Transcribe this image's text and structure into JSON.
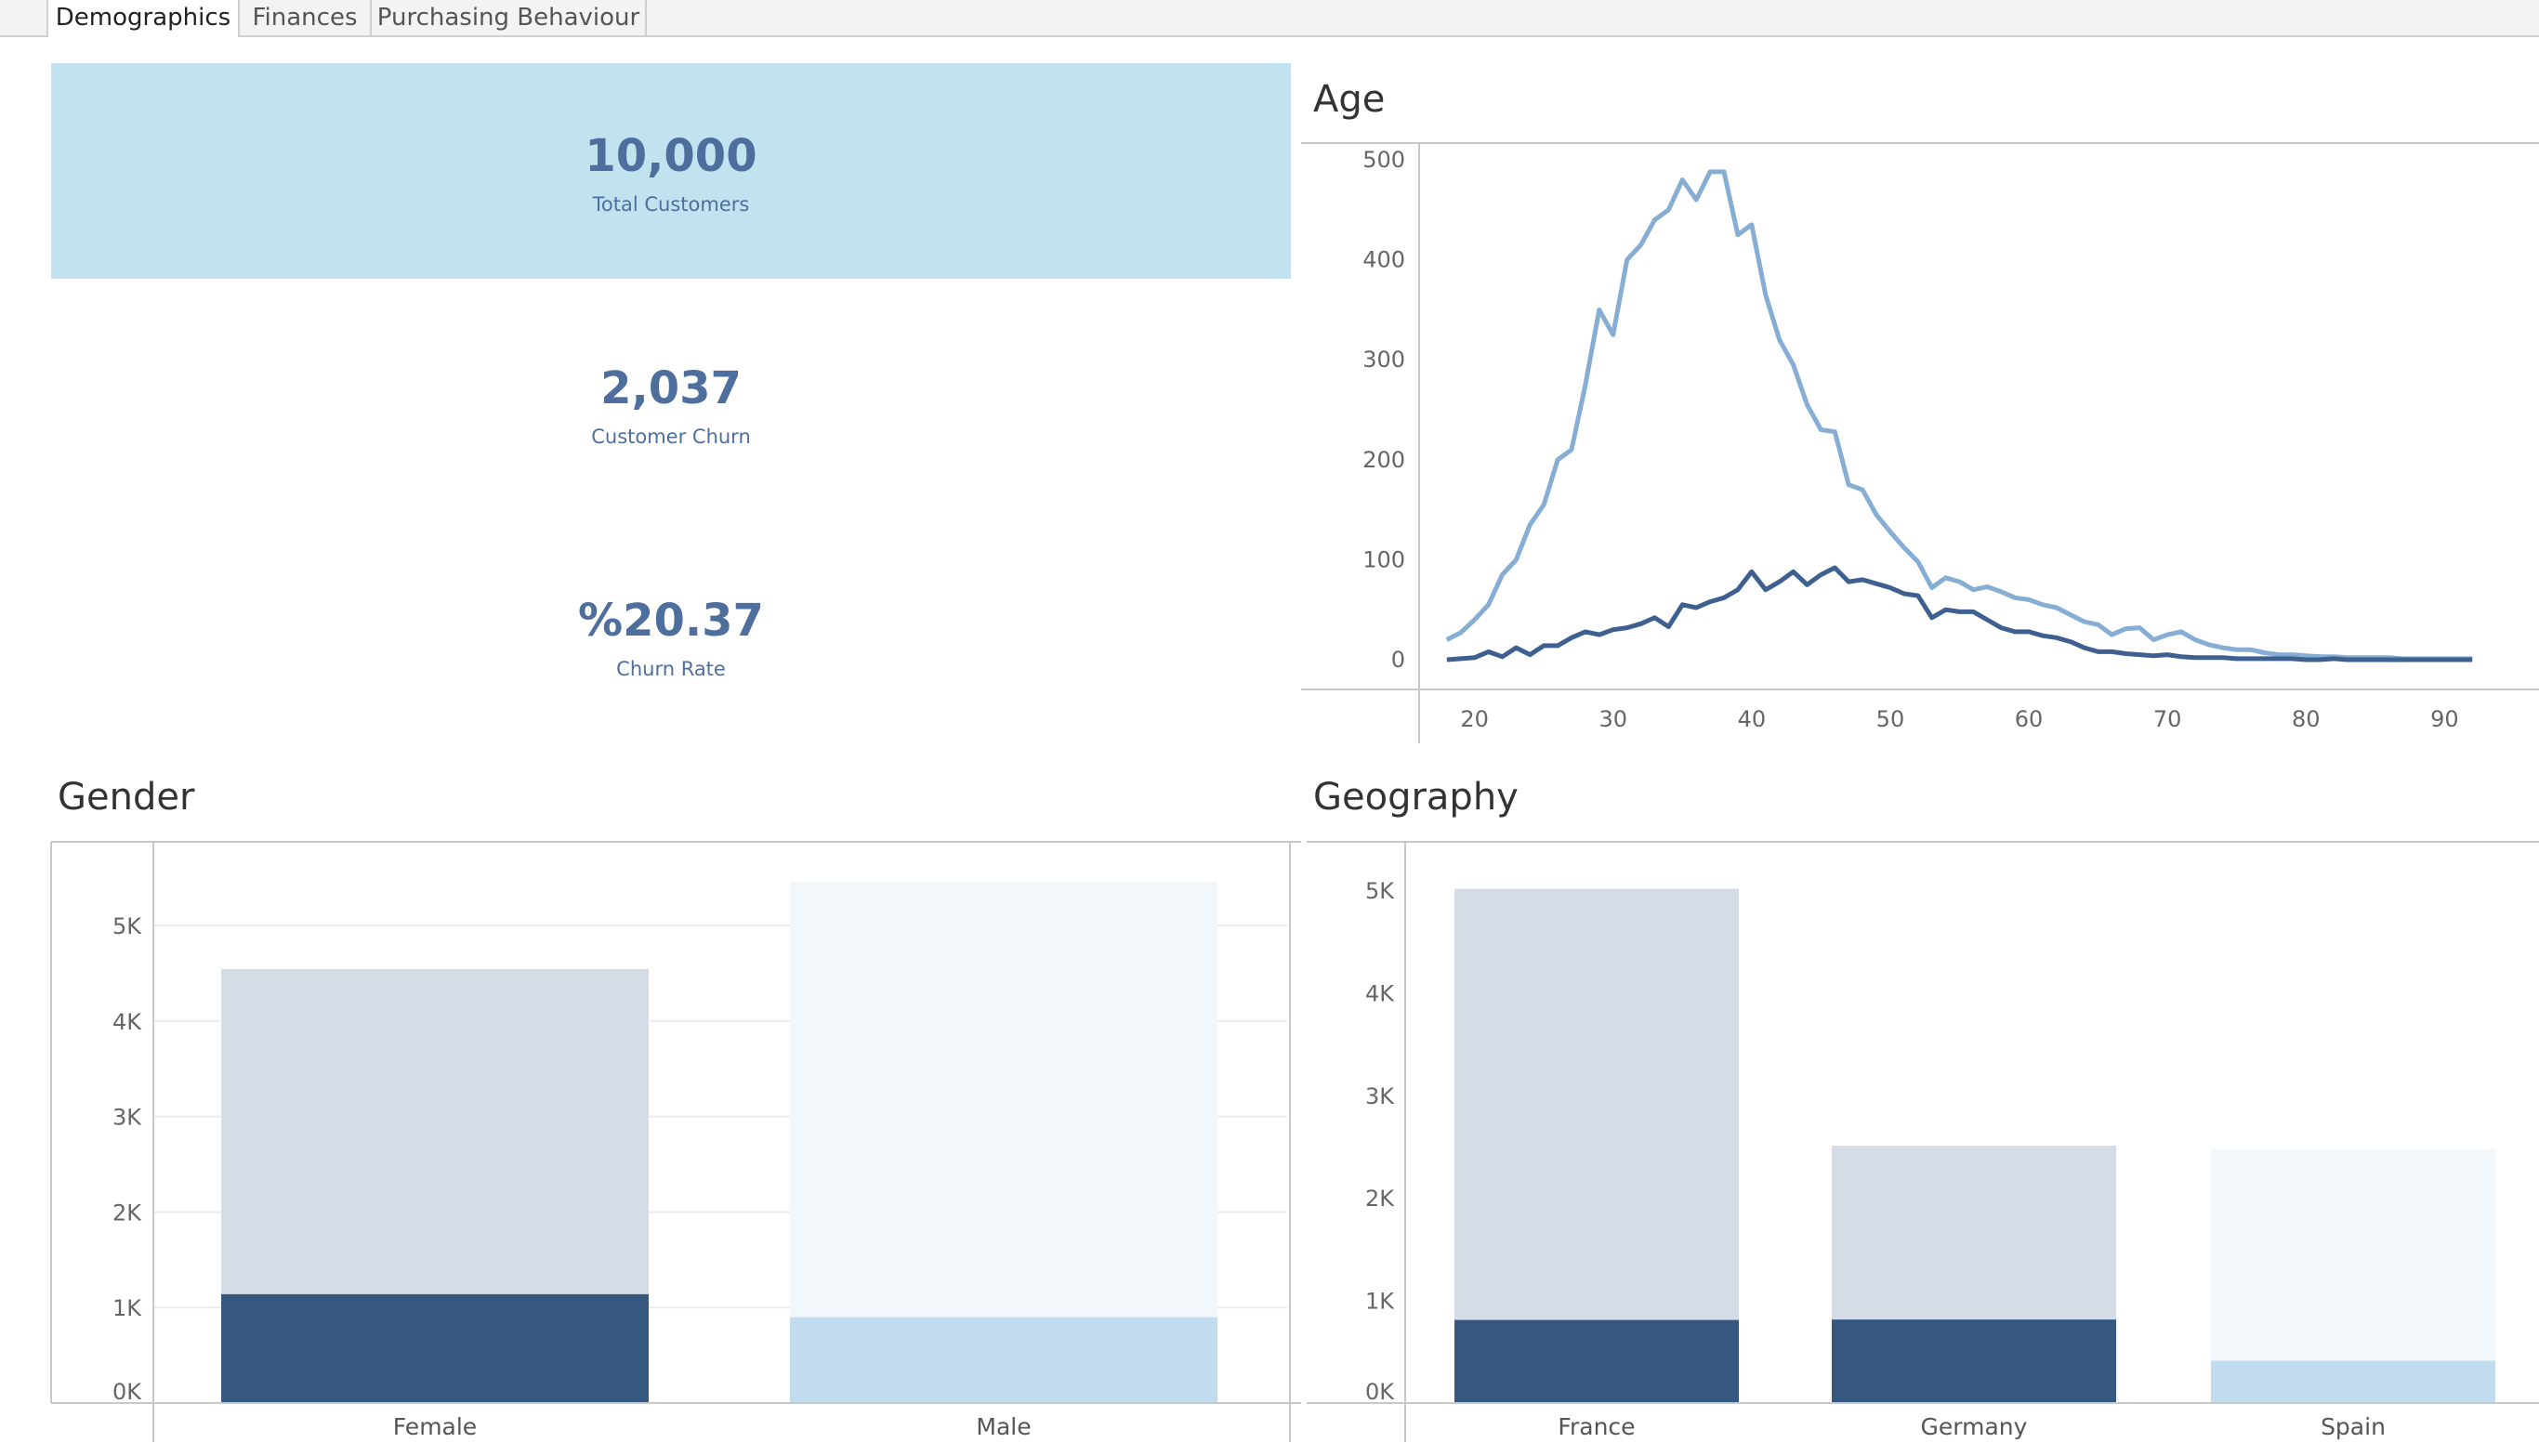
{
  "tabs": [
    {
      "label": "Demographics",
      "active": true
    },
    {
      "label": "Finances",
      "active": false
    },
    {
      "label": "Purchasing Behaviour",
      "active": false
    }
  ],
  "kpis": [
    {
      "value": "10,000",
      "label": "Total Customers"
    },
    {
      "value": "2,037",
      "label": "Customer Churn"
    },
    {
      "value": "%20.37",
      "label": "Churn Rate"
    }
  ],
  "colors": {
    "dark_blue": "#36577f",
    "light_blue": "#c2dcef",
    "grey_bar": "#d4dce5",
    "pale_bar": "#f2f7fb",
    "age_retained": "#86add4",
    "age_exited": "#3e6090",
    "kpi_fill": "#c2e2ef",
    "kpi_text": "#4e6f9d"
  },
  "chart_data": [
    {
      "type": "line",
      "title": "Age",
      "xlabel": "",
      "ylabel": "",
      "xlim": [
        16,
        94
      ],
      "ylim": [
        0,
        500
      ],
      "xticks": [
        "20",
        "30",
        "40",
        "50",
        "60",
        "70",
        "80",
        "90"
      ],
      "yticks": [
        "0",
        "100",
        "200",
        "300",
        "400",
        "500"
      ],
      "series": [
        {
          "x": [
            18,
            19,
            20,
            21,
            22,
            23,
            24,
            25,
            26,
            27,
            28,
            29,
            30,
            31,
            32,
            33,
            34,
            35,
            36,
            37,
            38,
            39,
            40,
            41,
            42,
            43,
            44,
            45,
            46,
            47,
            48,
            49,
            50,
            51,
            52,
            53,
            54,
            55,
            56,
            57,
            58,
            59,
            60,
            61,
            62,
            63,
            64,
            65,
            66,
            67,
            68,
            69,
            70,
            71,
            72,
            73,
            74,
            75,
            76,
            77,
            78,
            79,
            80,
            81,
            82,
            83,
            84,
            85,
            86,
            87,
            88,
            89,
            90,
            91,
            92
          ],
          "values": [
            20,
            27,
            40,
            55,
            85,
            100,
            135,
            155,
            200,
            210,
            275,
            350,
            325,
            400,
            415,
            440,
            450,
            480,
            460,
            488,
            488,
            425,
            435,
            365,
            320,
            295,
            255,
            230,
            228,
            175,
            170,
            145,
            128,
            112,
            98,
            72,
            82,
            78,
            70,
            73,
            68,
            62,
            60,
            55,
            52,
            45,
            38,
            35,
            25,
            31,
            32,
            20,
            25,
            28,
            20,
            15,
            12,
            10,
            10,
            7,
            5,
            5,
            4,
            3,
            3,
            2,
            2,
            2,
            2,
            1,
            1,
            1,
            1,
            1,
            1
          ]
        },
        {
          "x": [
            18,
            19,
            20,
            21,
            22,
            23,
            24,
            25,
            26,
            27,
            28,
            29,
            30,
            31,
            32,
            33,
            34,
            35,
            36,
            37,
            38,
            39,
            40,
            41,
            42,
            43,
            44,
            45,
            46,
            47,
            48,
            49,
            50,
            51,
            52,
            53,
            54,
            55,
            56,
            57,
            58,
            59,
            60,
            61,
            62,
            63,
            64,
            65,
            66,
            67,
            68,
            69,
            70,
            71,
            72,
            73,
            74,
            75,
            76,
            77,
            78,
            79,
            80,
            81,
            82,
            83,
            84,
            85,
            86,
            87,
            88,
            89,
            90,
            91,
            92
          ],
          "values": [
            0,
            1,
            2,
            8,
            3,
            12,
            5,
            14,
            14,
            22,
            28,
            25,
            30,
            32,
            36,
            42,
            33,
            55,
            52,
            58,
            62,
            70,
            88,
            70,
            78,
            88,
            75,
            85,
            92,
            78,
            80,
            76,
            72,
            66,
            64,
            42,
            50,
            48,
            48,
            40,
            32,
            28,
            28,
            24,
            22,
            18,
            12,
            8,
            8,
            6,
            5,
            4,
            5,
            3,
            2,
            2,
            2,
            1,
            1,
            1,
            1,
            1,
            0,
            0,
            1,
            0,
            0,
            0,
            0,
            0,
            0,
            0,
            0,
            0,
            0
          ]
        }
      ]
    },
    {
      "type": "bar",
      "title": "Gender",
      "xlabel": "",
      "ylabel": "",
      "categories": [
        "Female",
        "Male"
      ],
      "ylim": [
        0,
        5700
      ],
      "yticks": [
        "0K",
        "1K",
        "2K",
        "3K",
        "4K",
        "5K"
      ],
      "series": [
        {
          "values": [
            4543,
            5457
          ]
        },
        {
          "values": [
            1139,
            898
          ]
        }
      ]
    },
    {
      "type": "bar",
      "title": "Geography",
      "xlabel": "",
      "ylabel": "",
      "categories": [
        "France",
        "Germany",
        "Spain"
      ],
      "ylim": [
        0,
        5200
      ],
      "yticks": [
        "0K",
        "1K",
        "2K",
        "3K",
        "4K",
        "5K"
      ],
      "series": [
        {
          "values": [
            5014,
            2509,
            2477
          ]
        },
        {
          "values": [
            810,
            814,
            413
          ]
        }
      ]
    }
  ]
}
